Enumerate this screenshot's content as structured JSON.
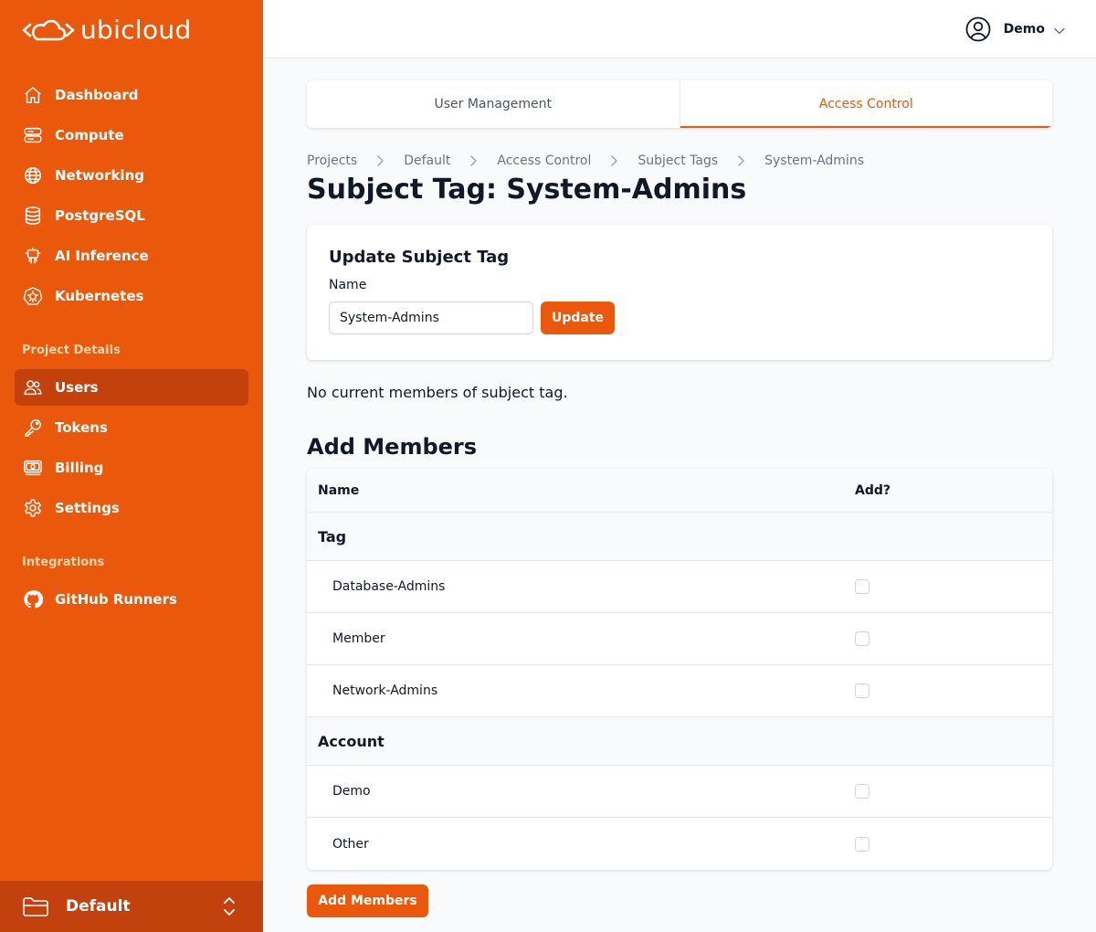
{
  "brand": {
    "name": "ubicloud"
  },
  "sidebar": {
    "main_nav": [
      {
        "label": "Dashboard",
        "icon": "home-icon"
      },
      {
        "label": "Compute",
        "icon": "server-icon"
      },
      {
        "label": "Networking",
        "icon": "globe-icon"
      },
      {
        "label": "PostgreSQL",
        "icon": "database-icon"
      },
      {
        "label": "AI Inference",
        "icon": "robot-icon"
      },
      {
        "label": "Kubernetes",
        "icon": "kubernetes-icon"
      }
    ],
    "project_section_label": "Project Details",
    "project_nav": [
      {
        "label": "Users",
        "icon": "users-icon",
        "active": true
      },
      {
        "label": "Tokens",
        "icon": "key-icon"
      },
      {
        "label": "Billing",
        "icon": "banknote-icon"
      },
      {
        "label": "Settings",
        "icon": "gear-icon"
      }
    ],
    "integrations_label": "Integrations",
    "integrations_nav": [
      {
        "label": "GitHub Runners",
        "icon": "github-icon"
      }
    ],
    "project_switcher": {
      "label": "Default",
      "icon": "folder-icon"
    }
  },
  "header": {
    "user_name": "Demo"
  },
  "tabs": [
    {
      "label": "User Management",
      "active": false
    },
    {
      "label": "Access Control",
      "active": true
    }
  ],
  "breadcrumb": [
    "Projects",
    "Default",
    "Access Control",
    "Subject Tags",
    "System-Admins"
  ],
  "page_title": "Subject Tag: System-Admins",
  "update_form": {
    "title": "Update Subject Tag",
    "name_label": "Name",
    "name_value": "System-Admins",
    "submit_label": "Update"
  },
  "members_empty_message": "No current members of subject tag.",
  "add_members": {
    "title": "Add Members",
    "columns": {
      "name": "Name",
      "add": "Add?"
    },
    "groups": [
      {
        "label": "Tag",
        "items": [
          "Database-Admins",
          "Member",
          "Network-Admins"
        ]
      },
      {
        "label": "Account",
        "items": [
          "Demo",
          "Other"
        ]
      }
    ],
    "submit_label": "Add Members"
  },
  "colors": {
    "accent": "#ea580c",
    "accent_dark": "#c2410c"
  }
}
